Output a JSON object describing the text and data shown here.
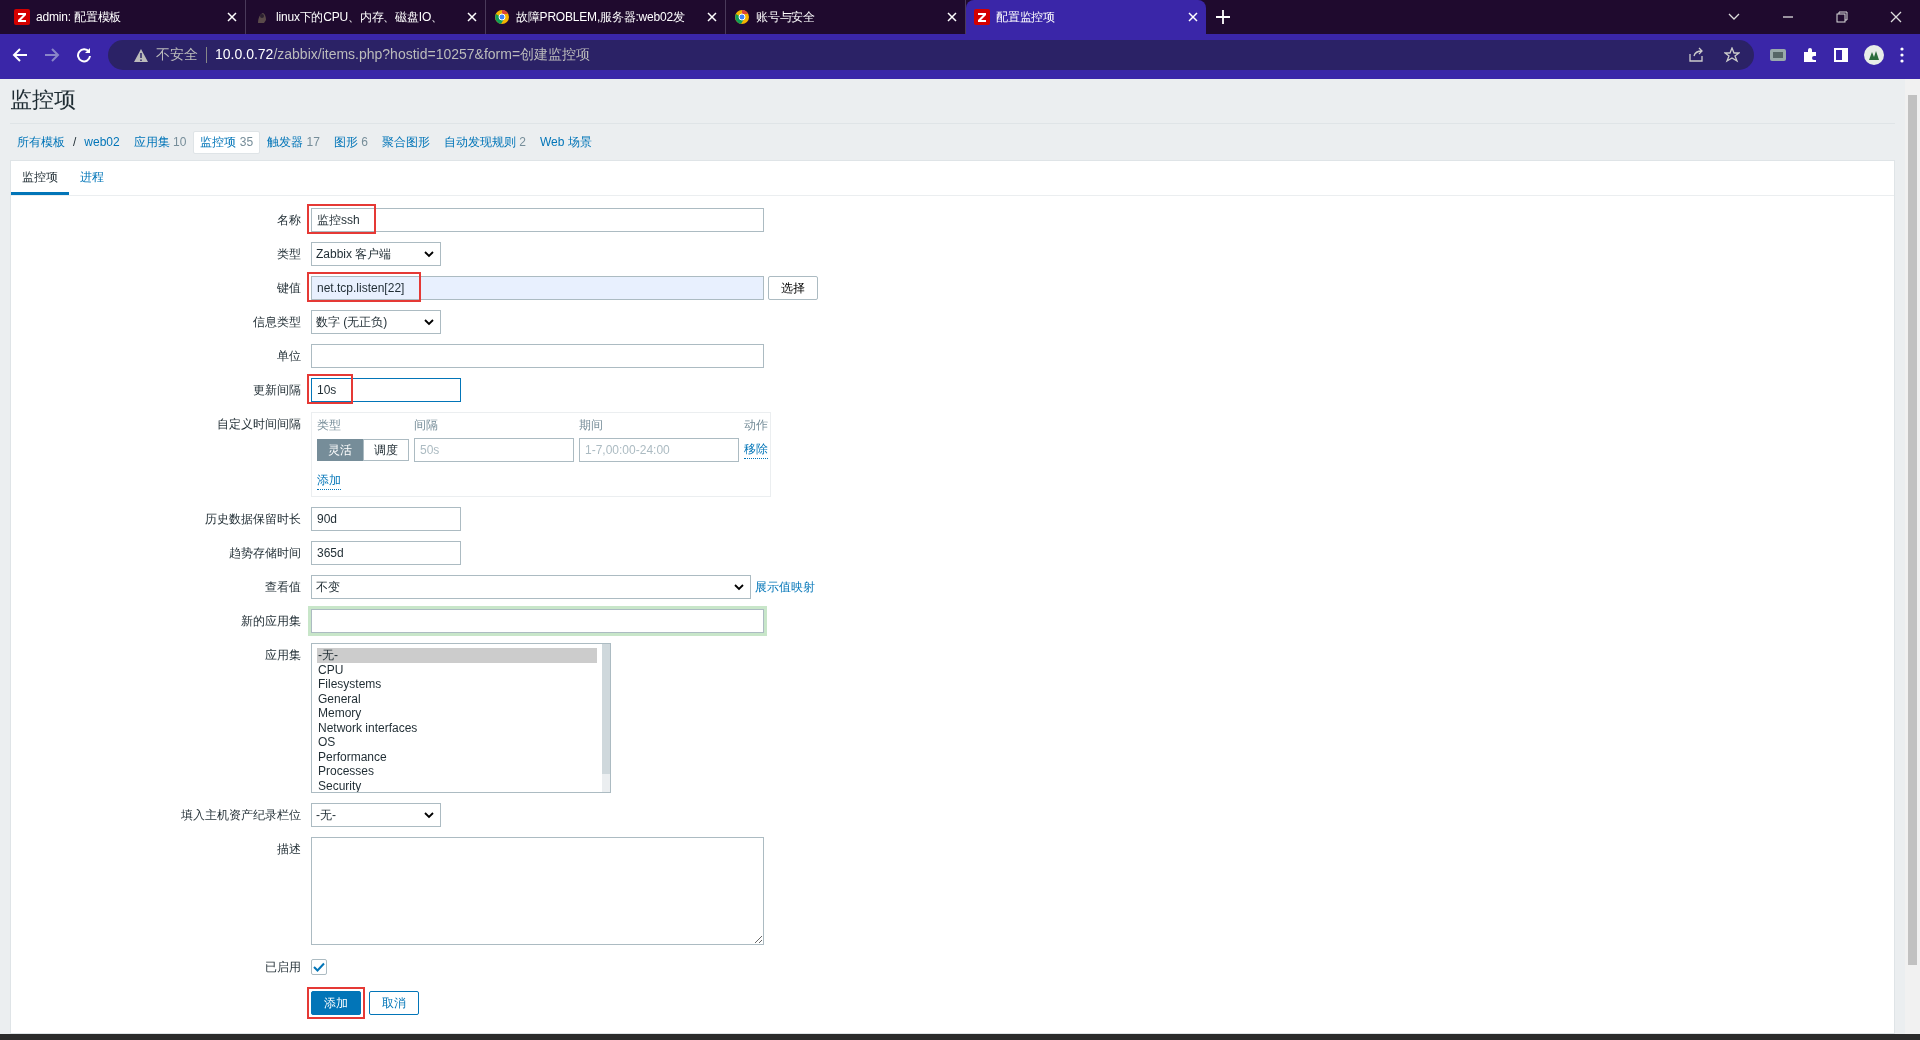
{
  "browser": {
    "tabs": [
      {
        "title": "admin: 配置模板",
        "kind": "zabbix",
        "selected": false
      },
      {
        "title": "linux下的CPU、内存、磁盘IO、",
        "kind": "site",
        "selected": false
      },
      {
        "title": "故障PROBLEM,服务器:web02发",
        "kind": "browser",
        "selected": false
      },
      {
        "title": "账号与安全",
        "kind": "browser",
        "selected": false
      },
      {
        "title": "配置监控项",
        "kind": "zabbix",
        "selected": true
      }
    ],
    "address": {
      "security": "不安全",
      "host": "10.0.0.72",
      "path": "/zabbix/items.php?hostid=10257&form=创建监控项"
    }
  },
  "page": {
    "title": "监控项",
    "breadcrumbs": [
      {
        "label": "所有模板"
      },
      {
        "label": "web02"
      }
    ],
    "breadcrumb_separator": "/",
    "nav": [
      {
        "label": "应用集",
        "count": "10",
        "selected": false
      },
      {
        "label": "监控项",
        "count": "35",
        "selected": true
      },
      {
        "label": "触发器",
        "count": "17",
        "selected": false
      },
      {
        "label": "图形",
        "count": "6",
        "selected": false
      },
      {
        "label": "聚合图形",
        "selected": false
      },
      {
        "label": "自动发现规则",
        "count": "2",
        "selected": false
      },
      {
        "label": "Web 场景",
        "selected": false
      }
    ],
    "subtabs": [
      {
        "label": "监控项",
        "selected": true
      },
      {
        "label": "进程",
        "selected": false
      }
    ],
    "form": [
      {
        "label": "名称",
        "kind": "text",
        "value": "监控ssh",
        "highlighted": true
      },
      {
        "label": "类型",
        "kind": "select",
        "value": "Zabbix 客户端"
      },
      {
        "label": "键值",
        "kind": "text_button",
        "value": "net.tcp.listen[22]",
        "button": "选择",
        "highlighted": true
      },
      {
        "label": "信息类型",
        "kind": "select",
        "value": "数字 (无正负)"
      },
      {
        "label": "单位",
        "kind": "text"
      },
      {
        "label": "更新间隔",
        "kind": "short_text",
        "value": "10s",
        "focused": true,
        "highlighted": true
      },
      {
        "label": "自定义时间间隔",
        "kind": "intervals",
        "headers": [
          "类型",
          "间隔",
          "期间",
          "动作"
        ],
        "rows": [
          {
            "modes": [
              {
                "label": "灵活",
                "selected": true
              },
              {
                "label": "调度",
                "selected": false
              }
            ],
            "interval_placeholder": "50s",
            "period_placeholder": "1-7,00:00-24:00",
            "action": "移除"
          }
        ],
        "add": "添加"
      },
      {
        "label": "历史数据保留时长",
        "kind": "short_text",
        "value": "90d"
      },
      {
        "label": "趋势存储时间",
        "kind": "short_text",
        "value": "365d"
      },
      {
        "label": "查看值",
        "kind": "select_link",
        "value": "不变",
        "link": "展示值映射"
      },
      {
        "label": "新的应用集",
        "kind": "text",
        "focused": true
      },
      {
        "label": "应用集",
        "kind": "listbox",
        "options": [
          {
            "label": "-无-",
            "selected": true
          },
          {
            "label": "CPU",
            "selected": false
          },
          {
            "label": "Filesystems",
            "selected": false
          },
          {
            "label": "General",
            "selected": false
          },
          {
            "label": "Memory",
            "selected": false
          },
          {
            "label": "Network interfaces",
            "selected": false
          },
          {
            "label": "OS",
            "selected": false
          },
          {
            "label": "Performance",
            "selected": false
          },
          {
            "label": "Processes",
            "selected": false
          },
          {
            "label": "Security",
            "selected": false
          }
        ]
      },
      {
        "label": "填入主机资产纪录栏位",
        "kind": "select",
        "value": "-无-"
      },
      {
        "label": "描述",
        "kind": "textarea"
      },
      {
        "label": "已启用",
        "kind": "checkbox",
        "checked": true
      }
    ],
    "buttons": [
      {
        "label": "添加",
        "primary": true,
        "highlighted": true
      },
      {
        "label": "取消",
        "primary": false,
        "highlighted": false
      }
    ]
  }
}
